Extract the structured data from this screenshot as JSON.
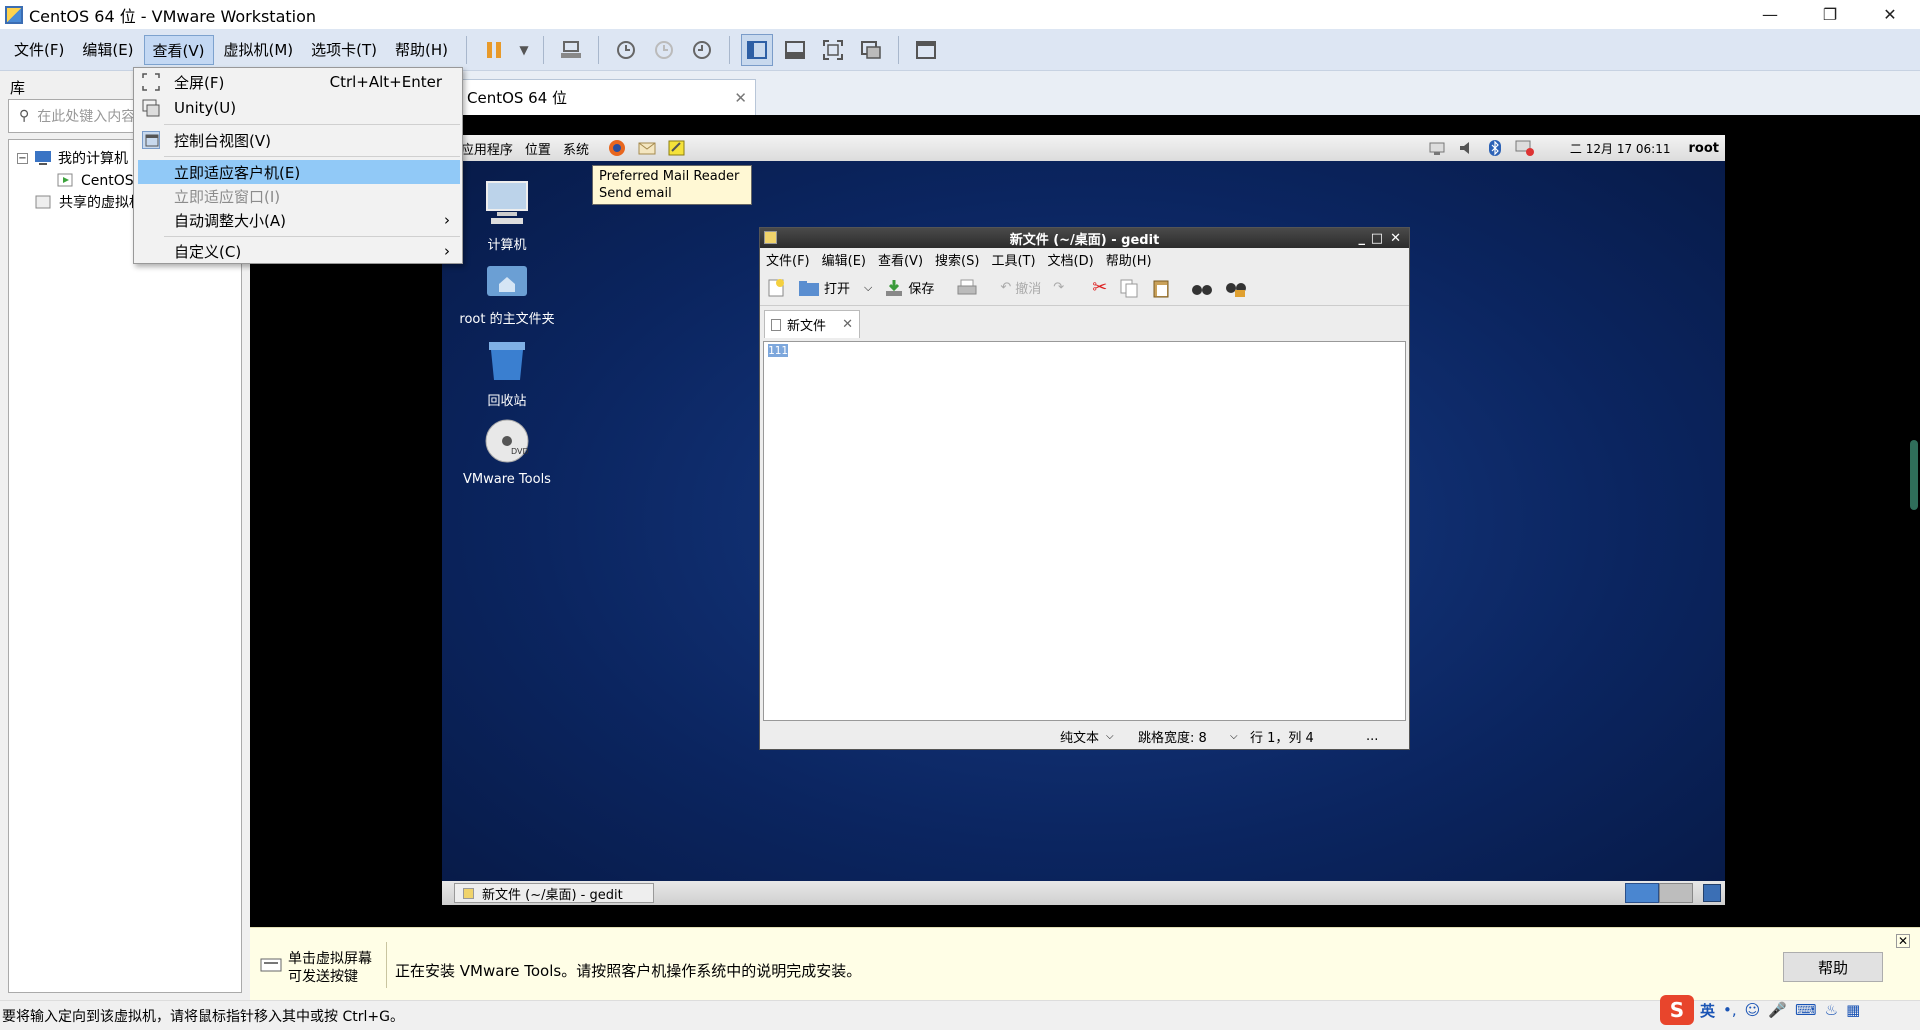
{
  "window": {
    "title": "CentOS 64 位 - VMware Workstation"
  },
  "menubar": {
    "items": [
      "文件(F)",
      "编辑(E)",
      "查看(V)",
      "虚拟机(M)",
      "选项卡(T)",
      "帮助(H)"
    ]
  },
  "view_menu": {
    "items": [
      {
        "label": "全屏(F)",
        "shortcut": "Ctrl+Alt+Enter"
      },
      {
        "label": "Unity(U)"
      },
      {
        "label": "控制台视图(V)"
      },
      {
        "label": "立即适应客户机(E)"
      },
      {
        "label": "立即适应窗口(I)"
      },
      {
        "label": "自动调整大小(A)",
        "arrow": "›"
      },
      {
        "label": "自定义(C)",
        "arrow": "›"
      }
    ]
  },
  "library": {
    "label": "库",
    "search_placeholder": "在此处键入内容进行搜索",
    "tree": [
      "我的计算机",
      "CentOS 64 位",
      "共享的虚拟机"
    ]
  },
  "vm_tab": {
    "label": "CentOS 64 位"
  },
  "guest": {
    "panel_menus": [
      "应用程序",
      "位置",
      "系统"
    ],
    "clock": "二 12月 17 06:11",
    "user": "root",
    "tooltip": [
      "Preferred Mail Reader",
      "Send email"
    ],
    "desktop_icons": [
      "计算机",
      "root 的主文件夹",
      "回收站",
      "VMware Tools"
    ],
    "taskbar_item": "新文件 (~/桌面) - gedit"
  },
  "gedit": {
    "title": "新文件 (~/桌面) - gedit",
    "menus": [
      "文件(F)",
      "编辑(E)",
      "查看(V)",
      "搜索(S)",
      "工具(T)",
      "文档(D)",
      "帮助(H)"
    ],
    "open_label": "打开",
    "save_label": "保存",
    "undo_label": "撤消",
    "tab_label": "新文件",
    "content": "111",
    "status_lang": "纯文本",
    "status_tab": "跳格宽度: 8",
    "status_pos": "行 1，列 4",
    "status_more": "..."
  },
  "infobar": {
    "hint_line1": "单击虚拟屏幕",
    "hint_line2": "可发送按键",
    "message": "正在安装 VMware Tools。请按照客户机操作系统中的说明完成安装。",
    "help_button": "帮助"
  },
  "statusbar": {
    "text": "要将输入定向到该虚拟机，请将鼠标指针移入其中或按 Ctrl+G。"
  },
  "ime": {
    "lang": "英"
  }
}
